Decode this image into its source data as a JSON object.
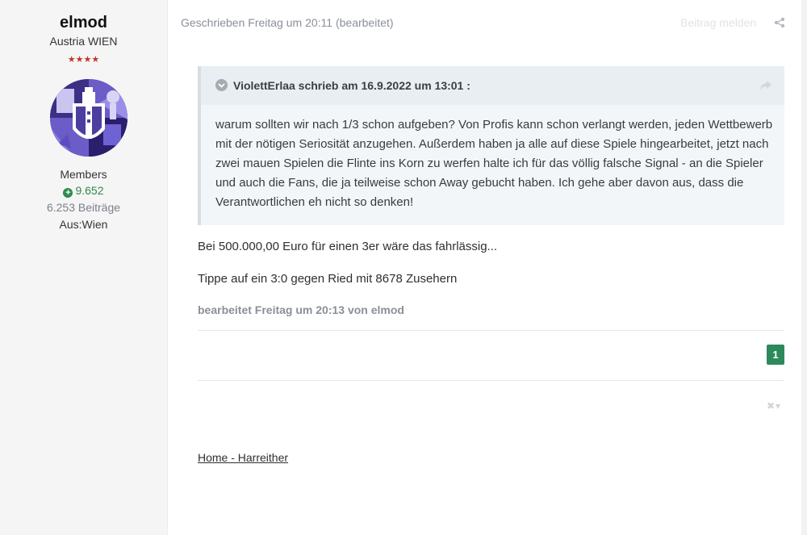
{
  "author": {
    "name": "elmod",
    "title": "Austria WIEN",
    "stars": "★★★★",
    "group": "Members",
    "reputation": "9.652",
    "post_count": "6.253 Beiträge",
    "location": "Aus:Wien"
  },
  "post": {
    "date": "Geschrieben Freitag um 20:11 (bearbeitet)",
    "report_label": "Beitrag melden",
    "quote": {
      "citation": "ViolettErlaa schrieb am 16.9.2022 um 13:01 :",
      "lines": [
        "warum sollten wir nach 1/3 schon aufgeben? Von Profis kann schon verlangt werden, jeden Wettbewerb",
        "mit der nötigen Seriosität anzugehen. Außerdem haben ja alle auf diese Spiele hingearbeitet, jetzt nach",
        "zwei mauen Spielen die Flinte ins Korn zu werfen halte ich für das völlig falsche Signal - an die Spieler",
        "und auch die Fans, die ja teilweise schon Away gebucht haben. Ich gehe aber davon aus, dass die",
        "Verantwortlichen eh nicht so denken!"
      ]
    },
    "paragraphs": [
      "Bei 500.000,00 Euro für einen 3er wäre das fahrlässig...",
      "Tippe auf ein 3:0 gegen Ried mit 8678 Zusehern"
    ],
    "edited_note": "bearbeitet Freitag um 20:13 von elmod",
    "reaction_count": "1",
    "signature_link": "Home - Harreither"
  },
  "colors": {
    "sidebar_bg": "#f5f5f5",
    "reputation_green": "#2f8a4e",
    "reaction_badge": "#2c8a5a",
    "quote_bg": "#f3f6f9",
    "stars_red": "#c0392b"
  },
  "icons": {
    "reputation": "plus-circle-icon",
    "share": "share-icon",
    "quote_toggle": "chevron-down-circle-icon",
    "quote_jump": "share-arrow-icon",
    "reaction_menu": "close-dropdown-icon"
  }
}
